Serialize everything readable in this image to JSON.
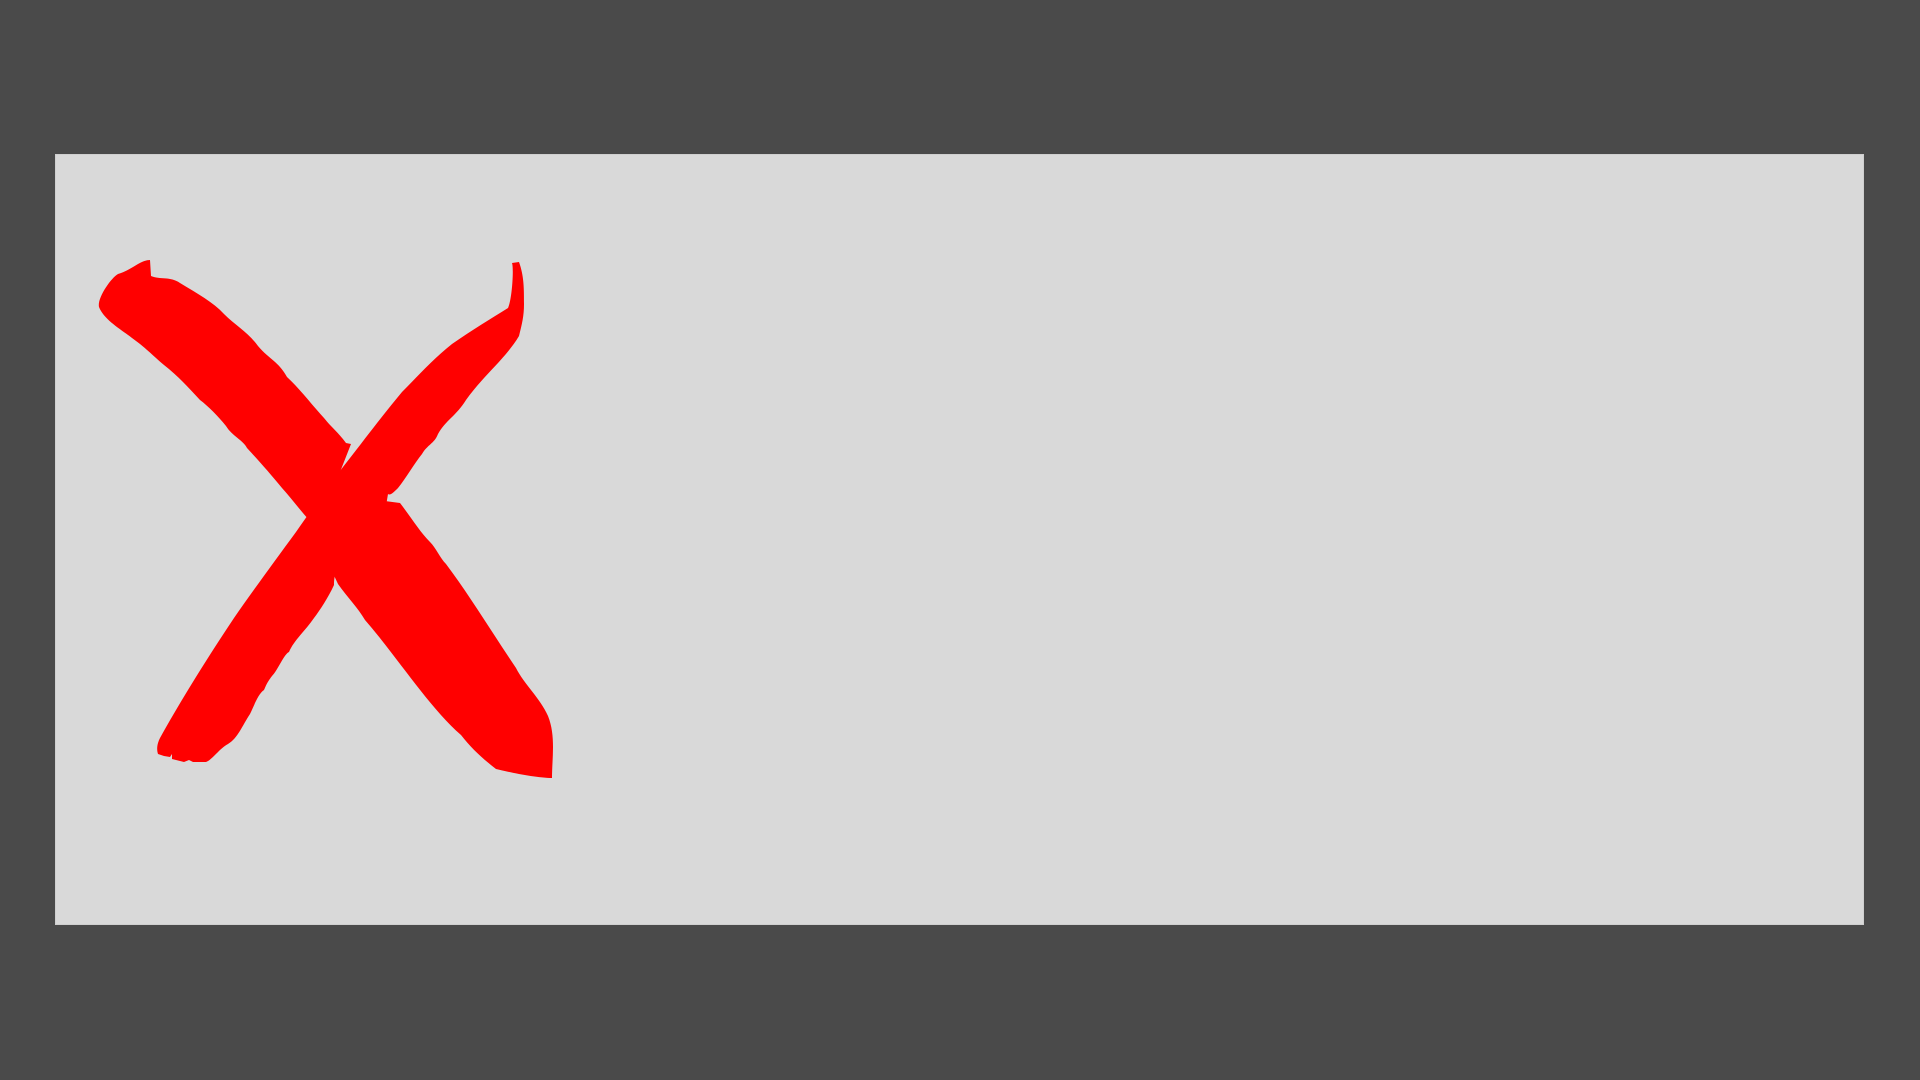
{
  "colors": {
    "background": "#4a4a4a",
    "panel": "#d9d9d9",
    "mark": "#ff0000"
  },
  "icons": {
    "mark": "red-x-cross-icon"
  }
}
